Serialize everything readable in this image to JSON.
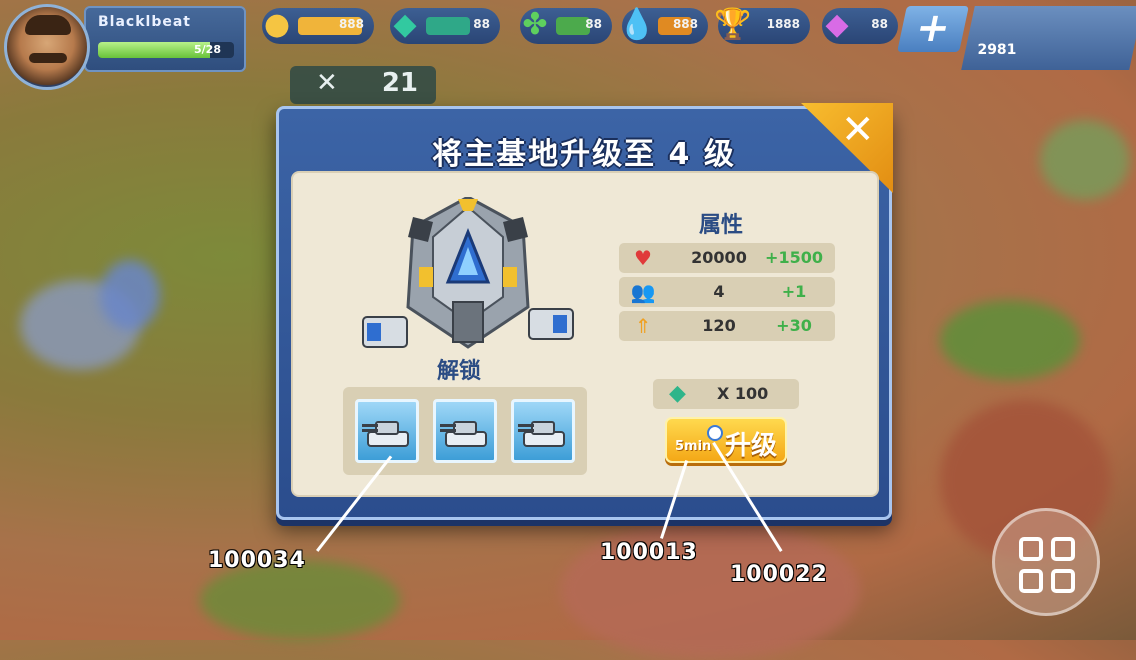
{
  "player": {
    "name": "Blacklbeat",
    "level": "5/28",
    "xp_fraction": 0.82
  },
  "resources": [
    {
      "name": "gold",
      "icon": "coin-icon",
      "value": "888",
      "color": "#f5c542",
      "fill": 0.75
    },
    {
      "name": "crystal",
      "icon": "crystal-icon",
      "value": "88",
      "color": "#32c9a0",
      "fill": 0.55
    },
    {
      "name": "plant",
      "icon": "leaf-icon",
      "value": "88",
      "color": "#5ed05e",
      "fill": 0.5
    },
    {
      "name": "oil",
      "icon": "oil-drop-icon",
      "value": "888",
      "color": "#f0a033",
      "fill": 0.65
    },
    {
      "name": "trophy",
      "icon": "trophy-icon",
      "value": "1888",
      "color": "#f5c542",
      "fill": 0
    },
    {
      "name": "gem",
      "icon": "gem-icon",
      "value": "88",
      "color": "#d86be6",
      "fill": 0
    }
  ],
  "top_right": {
    "value": "2981"
  },
  "troop_counter": {
    "symbol": "✕",
    "value": "21"
  },
  "dialog": {
    "title": "将主基地升级至 4 级",
    "close_symbol": "✕",
    "unlock_title": "解锁",
    "attributes_title": "属性",
    "attributes": [
      {
        "icon": "heart-icon",
        "value": "20000",
        "delta": "+1500"
      },
      {
        "icon": "people-icon",
        "value": "4",
        "delta": "+1"
      },
      {
        "icon": "arrow-up-icon",
        "value": "120",
        "delta": "+30"
      }
    ],
    "unlock_units": [
      "tank-unit-1",
      "tank-unit-2",
      "tank-unit-3"
    ],
    "cost": {
      "icon": "crystal-icon",
      "value": "X 100"
    },
    "upgrade_button": {
      "time": "5min",
      "label": "升级"
    }
  },
  "annotations": [
    "100034",
    "100013",
    "100022"
  ]
}
